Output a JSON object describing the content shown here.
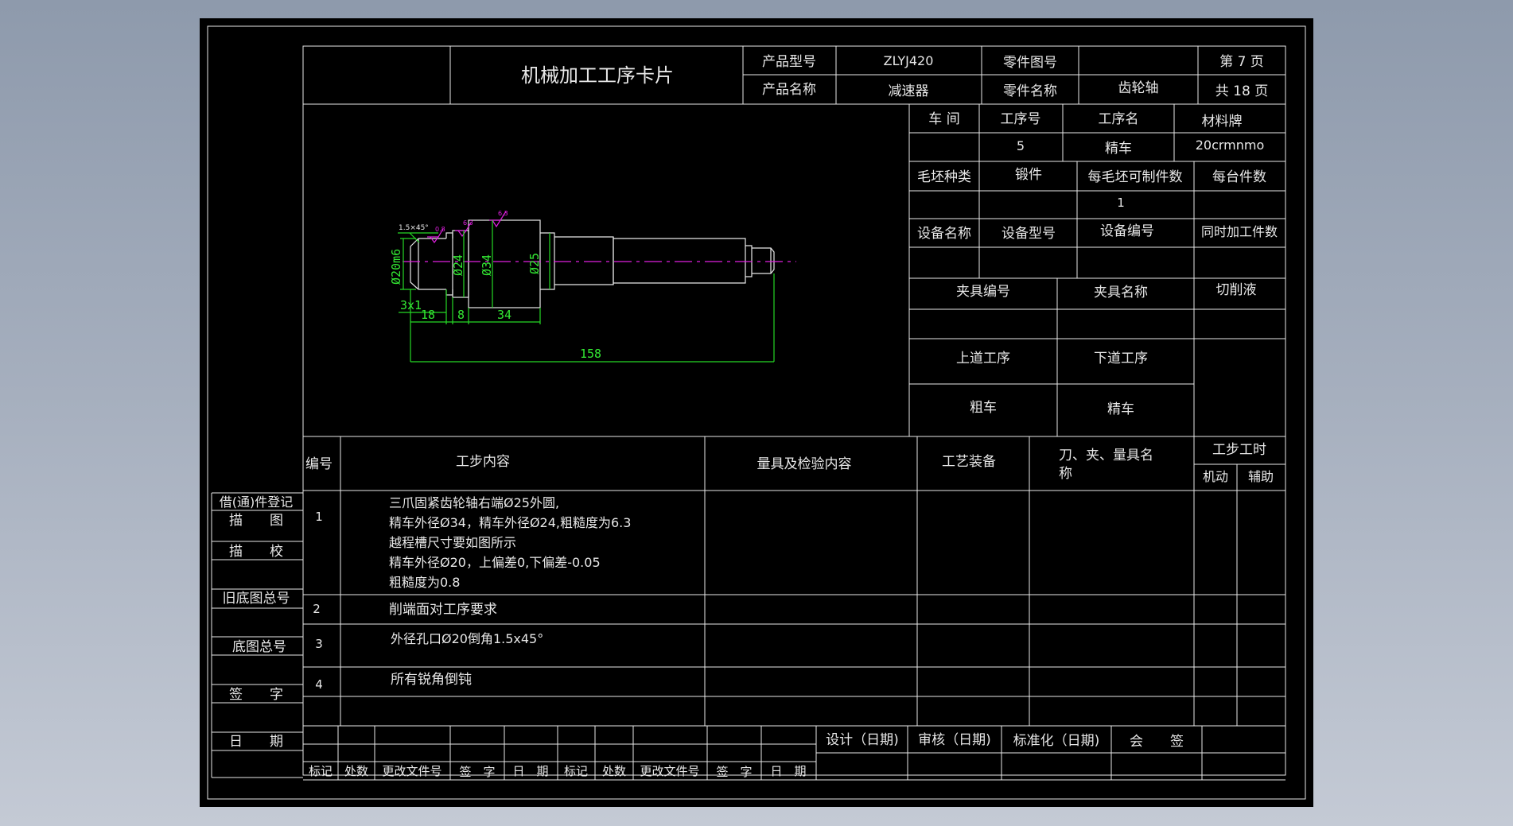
{
  "card": {
    "title": "机械加工工序卡片",
    "product_model_label": "产品型号",
    "product_model": "ZLYJ420",
    "part_drawing_no_label": "零件图号",
    "part_drawing_no": "",
    "page_label": "第 7 页",
    "product_name_label": "产品名称",
    "product_name": "减速器",
    "part_name_label": "零件名称",
    "part_name": "齿轮轴",
    "total_pages_label": "共 18 页"
  },
  "info": {
    "workshop_label": "车 间",
    "op_no_label": "工序号",
    "op_name_label": "工序名",
    "material_label": "材料牌",
    "workshop": "",
    "op_no": "5",
    "op_name": "精车",
    "material": "20crmnmo",
    "blank_type_label": "毛坯种类",
    "blank_type": "锻件",
    "pieces_per_blank_label": "每毛坯可制件数",
    "pieces_per_unit_label": "每台件数",
    "pieces_per_blank": "1",
    "equip_name_label": "设备名称",
    "equip_model_label": "设备型号",
    "equip_no_label": "设备编号",
    "simul_label": "同时加工件数",
    "fixture_no_label": "夹具编号",
    "fixture_name_label": "夹具名称",
    "coolant_label": "切削液",
    "prev_op_label": "上道工序",
    "next_op_label": "下道工序",
    "prev_op": "粗车",
    "next_op": "精车"
  },
  "drawing": {
    "chamfer_note": "1.5×45°",
    "rough1": "0.8",
    "rough2": "6.3",
    "rough3": "6.3",
    "d20": "Ø20m6",
    "d24": "Ø24",
    "d34": "Ø34",
    "d25": "Ø25",
    "groove": "3x1",
    "l18": "18",
    "l8": "8",
    "l34": "34",
    "l158": "158"
  },
  "steps": {
    "headers": {
      "no": "编号",
      "content": "工步内容",
      "inspect": "量具及检验内容",
      "equip": "工艺装备",
      "tools_line1": "刀、夹、量具名",
      "tools_line2": "称",
      "time": "工步工时",
      "machine": "机动",
      "aux": "辅助"
    },
    "rows": [
      {
        "no": "1",
        "lines": [
          "三爪固紧齿轮轴右端Ø25外圆,",
          "精车外径Ø34，精车外径Ø24,粗糙度为6.3",
          "越程槽尺寸要如图所示",
          "精车外径Ø20，上偏差0,下偏差-0.05",
          "粗糙度为0.8"
        ]
      },
      {
        "no": "2",
        "lines": [
          "削端面对工序要求"
        ]
      },
      {
        "no": "3",
        "lines": [
          "外径孔口Ø20倒角1.5x45°"
        ]
      },
      {
        "no": "4",
        "lines": [
          "所有锐角倒钝"
        ]
      }
    ]
  },
  "side": {
    "borrow": "借(通)件登记",
    "trace": "描　　图",
    "check": "描　　校",
    "old_no": "旧底图总号",
    "base_no": "底图总号",
    "sign": "签　　字",
    "date": "日　　期"
  },
  "footer": {
    "mark": "标记",
    "place": "处数",
    "change_doc": "更改文件号",
    "signature": "签　字",
    "date": "日　期",
    "design": "设计（日期)",
    "review": "审核（日期)",
    "standard": "标准化（日期)",
    "countersign": "会　　签"
  },
  "colors": {
    "background": "#000000",
    "lines": "#e8e8e8",
    "dimension": "#25d825",
    "center_line": "#e020e0"
  }
}
